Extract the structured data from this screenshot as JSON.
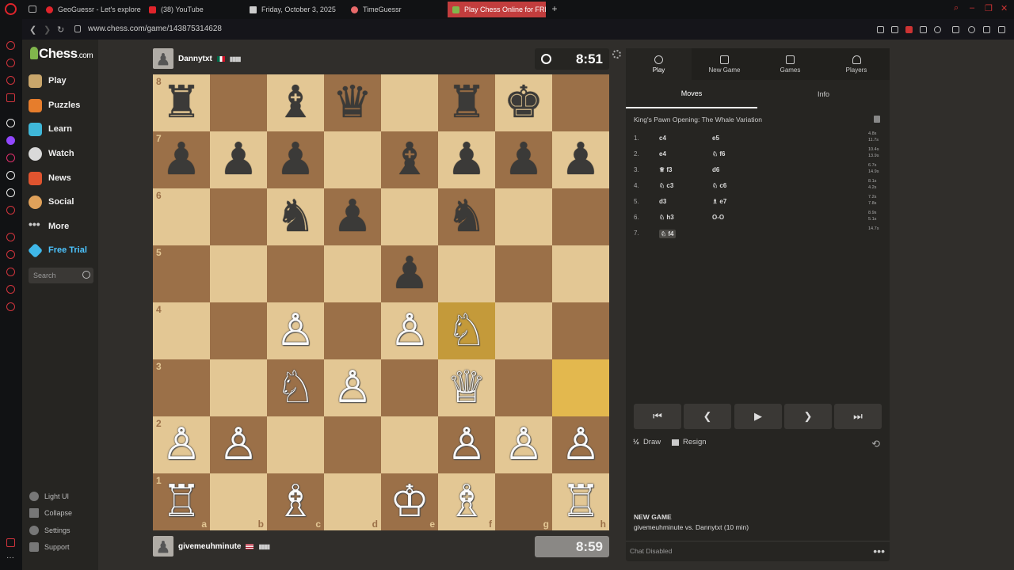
{
  "browser": {
    "tabs": [
      {
        "label": "GeoGuessr - Let's explore",
        "color": "#e0242b"
      },
      {
        "label": "(38) YouTube",
        "color": "#e0242b"
      },
      {
        "label": "Friday, October 3, 2025",
        "color": "#cccccc"
      },
      {
        "label": "TimeGuessr",
        "color": "#e86a6a"
      },
      {
        "label": "Play Chess Online for FRE",
        "color": "#81b64c"
      }
    ],
    "url": "www.chess.com/game/143875314628"
  },
  "sidebar": {
    "logo_main": "Chess",
    "logo_suffix": ".com",
    "nav": [
      {
        "label": "Play",
        "icon": "play-icon",
        "color": "#c9a66b"
      },
      {
        "label": "Puzzles",
        "icon": "puzzle-icon",
        "color": "#e67d2c"
      },
      {
        "label": "Learn",
        "icon": "learn-icon",
        "color": "#3fb7d8"
      },
      {
        "label": "Watch",
        "icon": "watch-icon",
        "color": "#d9d9d9"
      },
      {
        "label": "News",
        "icon": "news-icon",
        "color": "#e0542f"
      },
      {
        "label": "Social",
        "icon": "social-icon",
        "color": "#e0a15a"
      },
      {
        "label": "More",
        "icon": "more-icon",
        "color": "#cccccc"
      },
      {
        "label": "Free Trial",
        "icon": "diamond-icon",
        "color": "#3fb7e8"
      }
    ],
    "search_placeholder": "Search",
    "bottom": [
      {
        "label": "Light UI"
      },
      {
        "label": "Collapse"
      },
      {
        "label": "Settings"
      },
      {
        "label": "Support"
      }
    ]
  },
  "game": {
    "top_player": {
      "name": "Dannytxt",
      "flag": "mexico-flag",
      "signal": "▮▮▮▮"
    },
    "bottom_player": {
      "name": "givemeuhminute",
      "flag": "usa-flag",
      "signal": "▮▮▮▮"
    },
    "top_clock": "8:51",
    "bottom_clock": "8:59"
  },
  "board": {
    "ranks": [
      "8",
      "7",
      "6",
      "5",
      "4",
      "3",
      "2",
      "1"
    ],
    "files": [
      "a",
      "b",
      "c",
      "d",
      "e",
      "f",
      "g",
      "h"
    ],
    "rows": [
      [
        "♜",
        "",
        "♝",
        "♛",
        "",
        "♜",
        "♚",
        ""
      ],
      [
        "♟",
        "♟",
        "♟",
        "",
        "♝",
        "♟",
        "♟",
        "♟"
      ],
      [
        "",
        "",
        "♞",
        "♟",
        "",
        "♞",
        "",
        ""
      ],
      [
        "",
        "",
        "",
        "",
        "♟",
        "",
        "",
        ""
      ],
      [
        "",
        "",
        "♙",
        "",
        "♙",
        "♘",
        "",
        ""
      ],
      [
        "",
        "",
        "♘",
        "♙",
        "",
        "♕",
        "",
        ""
      ],
      [
        "♙",
        "♙",
        "",
        "",
        "",
        "♙",
        "♙",
        "♙"
      ],
      [
        "♖",
        "",
        "♗",
        "",
        "♔",
        "♗",
        "",
        "♖"
      ]
    ],
    "highlights": [
      "f4",
      "h3"
    ]
  },
  "panel": {
    "tabs": [
      {
        "label": "Play"
      },
      {
        "label": "New Game"
      },
      {
        "label": "Games"
      },
      {
        "label": "Players"
      }
    ],
    "subtabs": [
      "Moves",
      "Info"
    ],
    "opening": "King's Pawn Opening: The Whale Variation",
    "moves": [
      {
        "n": "1.",
        "w": "c4",
        "b": "e5",
        "tw": "4.8s",
        "tb": "11.7s"
      },
      {
        "n": "2.",
        "w": "e4",
        "b": "♘ f6",
        "tw": "10.4s",
        "tb": "13.9s"
      },
      {
        "n": "3.",
        "w": "♕ f3",
        "b": "d6",
        "tw": "6.7s",
        "tb": "14.9s"
      },
      {
        "n": "4.",
        "w": "♘ c3",
        "b": "♘ c6",
        "tw": "8.1s",
        "tb": "4.2s"
      },
      {
        "n": "5.",
        "w": "d3",
        "b": "♗ e7",
        "tw": "7.2s",
        "tb": "7.8s"
      },
      {
        "n": "6.",
        "w": "♘ h3",
        "b": "O-O",
        "tw": "8.9s",
        "tb": "5.1s"
      },
      {
        "n": "7.",
        "w": "♘ f4",
        "b": "",
        "tw": "14.7s",
        "tb": ""
      }
    ],
    "controls": [
      "⏮",
      "❮",
      "▶",
      "❯",
      "⏭"
    ],
    "draw_label": "Draw",
    "draw_icon_text": "½",
    "resign_label": "Resign",
    "new_game_title": "NEW GAME",
    "new_game_desc": "givemeuhminute vs. Dannytxt (10 min)",
    "chat": "Chat Disabled"
  }
}
